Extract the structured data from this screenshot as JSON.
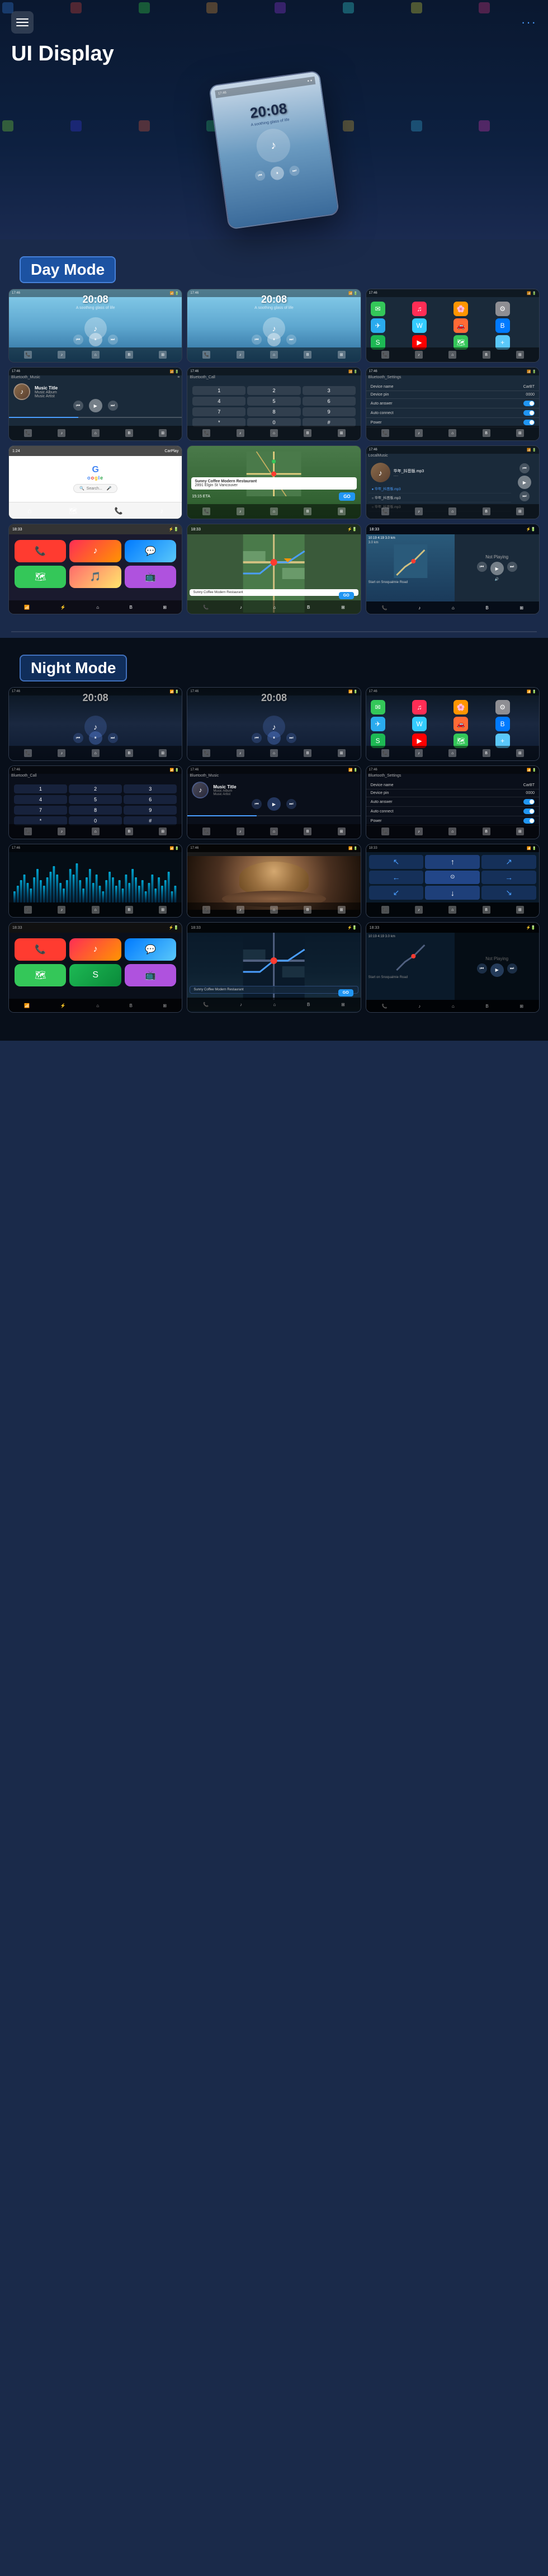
{
  "header": {
    "menu_icon": "≡",
    "nav_dots": "···",
    "title": "UI Display"
  },
  "day_mode": {
    "label": "Day Mode",
    "screens": [
      {
        "id": "day-music-1",
        "type": "day-music",
        "time": "20:08",
        "subtitle": "A soothing glass of life"
      },
      {
        "id": "day-music-2",
        "type": "day-music",
        "time": "20:08",
        "subtitle": "A soothing glass of life"
      },
      {
        "id": "day-apps",
        "type": "day-apps"
      },
      {
        "id": "bt-music",
        "type": "bluetooth-music",
        "label": "Bluetooth_Music"
      },
      {
        "id": "bt-call",
        "type": "bluetooth-call",
        "label": "Bluetooth_Call"
      },
      {
        "id": "bt-settings",
        "type": "bluetooth-settings",
        "label": "Bluetooth_Settings"
      },
      {
        "id": "carplay-google",
        "type": "carplay",
        "label": "Google"
      },
      {
        "id": "navigation",
        "type": "navigation"
      },
      {
        "id": "local-music",
        "type": "local-music",
        "label": "LocalMusic"
      }
    ]
  },
  "night_mode": {
    "label": "Night Mode",
    "screens": [
      {
        "id": "night-music-1",
        "type": "night-music",
        "time": "20:08"
      },
      {
        "id": "night-music-2",
        "type": "night-music",
        "time": "20:08"
      },
      {
        "id": "night-apps",
        "type": "night-apps"
      },
      {
        "id": "night-bt-call",
        "type": "night-bt-call",
        "label": "Bluetooth_Call"
      },
      {
        "id": "night-bt-music",
        "type": "night-bt-music",
        "label": "Bluetooth_Music"
      },
      {
        "id": "night-bt-settings",
        "type": "night-bt-settings",
        "label": "Bluetooth_Settings"
      },
      {
        "id": "night-waveform",
        "type": "night-waveform"
      },
      {
        "id": "night-video",
        "type": "night-video"
      },
      {
        "id": "night-nav-detail",
        "type": "night-nav-detail"
      },
      {
        "id": "night-carplay",
        "type": "night-carplay"
      },
      {
        "id": "night-nav2",
        "type": "night-nav2"
      },
      {
        "id": "night-nav3",
        "type": "night-nav3"
      }
    ]
  },
  "music": {
    "title": "Music Title",
    "album": "Music Album",
    "artist": "Music Artist"
  },
  "navigation": {
    "restaurant": "Sunny Coffee Modern Restaurant",
    "address": "2891 Elgin St Vancouver",
    "eta": "15:15 ETA",
    "distance": "9.9 km",
    "go_btn": "GO",
    "start_label": "Start on Snoqualmie Road",
    "arrival": "10:19 4:19 3.0 km"
  },
  "settings": {
    "device_name_label": "Device name",
    "device_name_val": "CarBT",
    "device_pin_label": "Device pin",
    "device_pin_val": "0000",
    "auto_answer_label": "Auto answer",
    "auto_connect_label": "Auto connect",
    "power_label": "Power"
  },
  "app_colors": {
    "red": "#FF3B30",
    "green": "#34C759",
    "blue": "#007AFF",
    "orange": "#FF9500",
    "purple": "#AF52DE",
    "yellow": "#FFCC00",
    "teal": "#5AC8FA",
    "pink": "#FF2D55"
  }
}
